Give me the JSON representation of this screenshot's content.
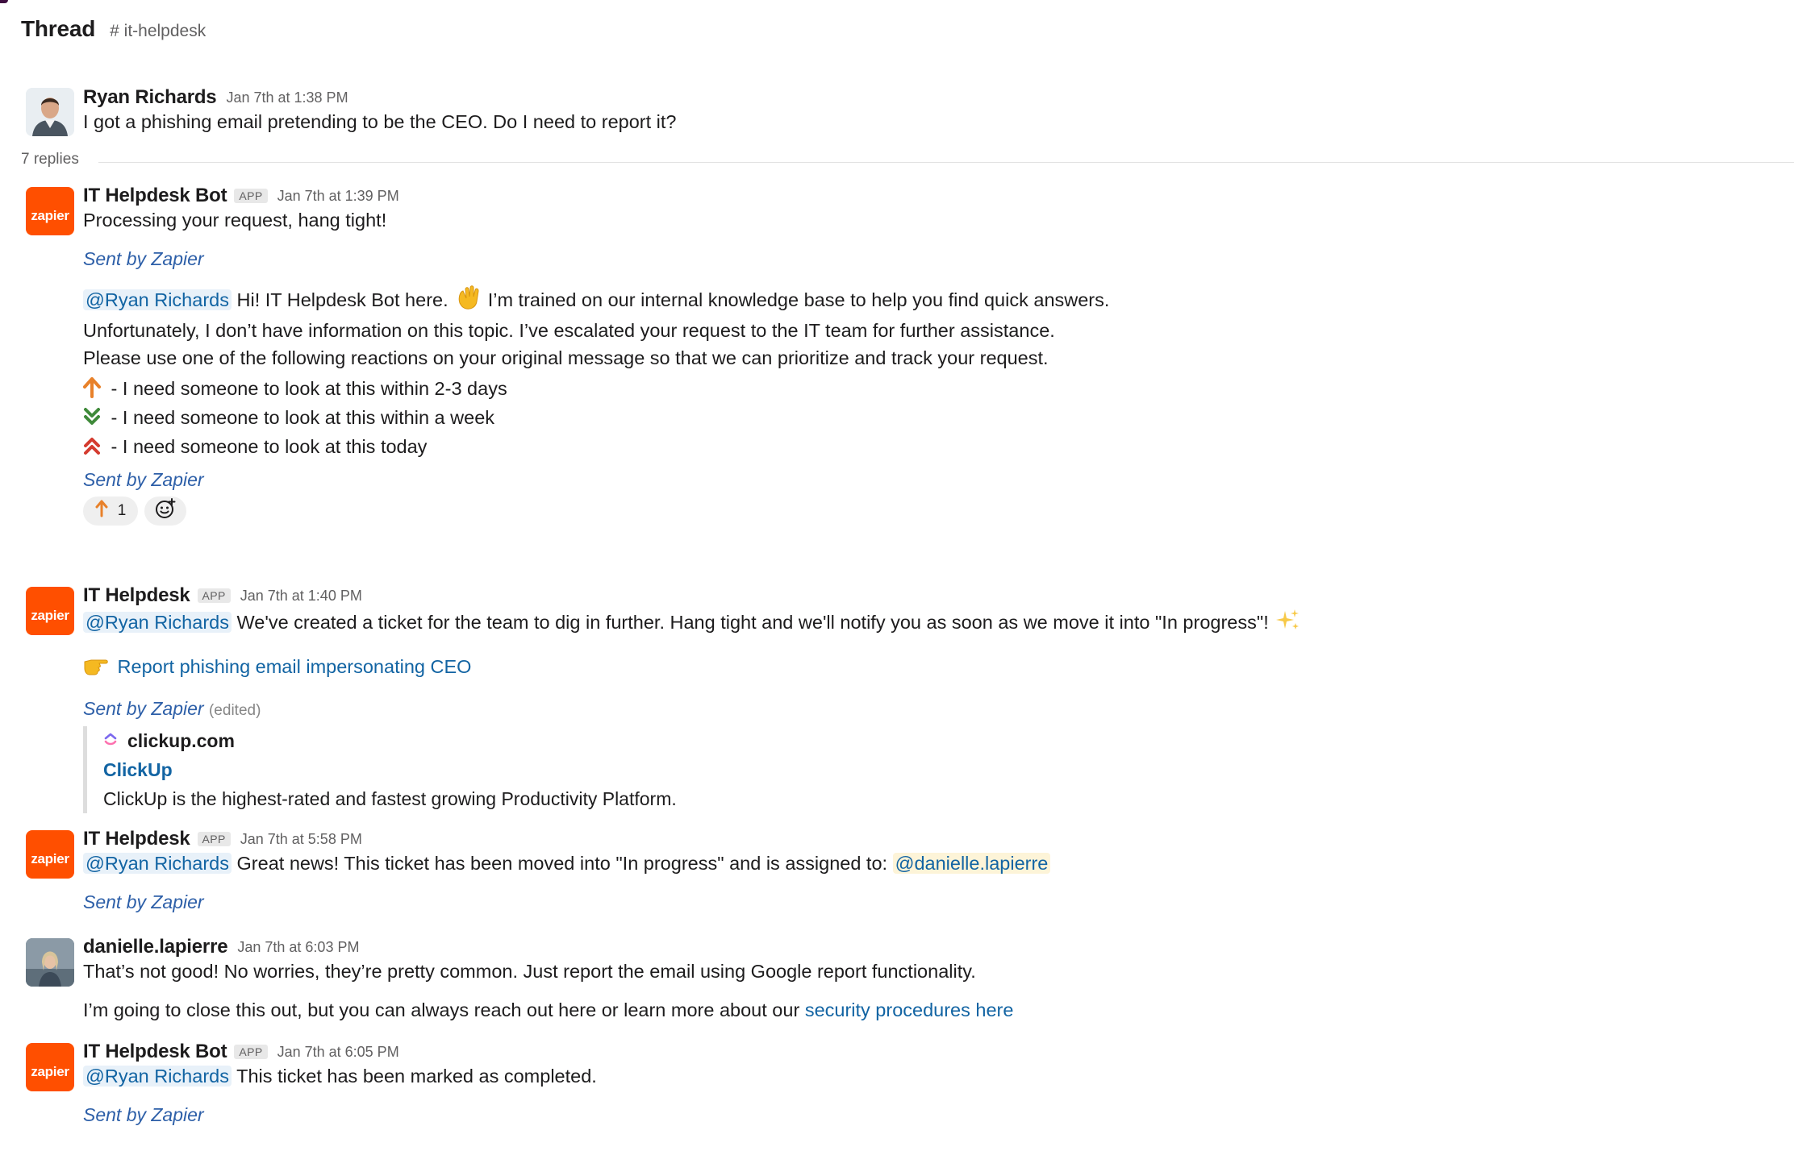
{
  "header": {
    "title": "Thread",
    "channel": "# it-helpdesk"
  },
  "colors": {
    "accent_link": "#1264a3",
    "zapier_orange": "#ff4f00",
    "sent_by": "#2d5fa8"
  },
  "parent": {
    "author": "Ryan Richards",
    "time": "Jan 7th at 1:38 PM",
    "text": "I got a phishing email pretending to be the CEO. Do I need to report it?"
  },
  "replies_label": "7 replies",
  "messages": [
    {
      "author": "IT Helpdesk Bot",
      "badge": "APP",
      "time": "Jan 7th at 1:39 PM",
      "line1": "Processing your request, hang tight!",
      "sent_by_1": "Sent by Zapier",
      "mention": "@Ryan Richards",
      "greeting_a": "Hi! IT Helpdesk Bot here.",
      "greeting_b": "I’m trained on our internal knowledge base to help you find quick answers.",
      "line3": "Unfortunately, I don’t have information on this topic. I’ve escalated your request to the IT team for further assistance.",
      "line4": "Please use one of the following reactions on your original message so that we can prioritize and track your request.",
      "options": [
        {
          "icon": "arrow-up-icon",
          "text": "- I need someone to look at this within 2-3 days"
        },
        {
          "icon": "double-chevron-down-icon",
          "text": "- I need someone to look at this within a week"
        },
        {
          "icon": "double-chevron-up-icon",
          "text": "- I need someone to look at this today"
        }
      ],
      "sent_by_2": "Sent by Zapier",
      "reaction": {
        "icon": "arrow-up-icon",
        "count": "1"
      }
    },
    {
      "author": "IT Helpdesk",
      "badge": "APP",
      "time": "Jan 7th at 1:40 PM",
      "mention": "@Ryan Richards",
      "text": "We've created a ticket for the team to dig in further. Hang tight and we'll notify you as soon as we move it into \"In progress\"!",
      "ticket_link": "Report phishing email impersonating CEO",
      "sent_by": "Sent by Zapier",
      "edited": "(edited)",
      "unfurl": {
        "site": "clickup.com",
        "title": "ClickUp",
        "description": "ClickUp is the highest-rated and fastest growing Productivity Platform."
      }
    },
    {
      "author": "IT Helpdesk",
      "badge": "APP",
      "time": "Jan 7th at 5:58 PM",
      "mention": "@Ryan Richards",
      "text": "Great news! This ticket has been moved into \"In progress\" and is assigned to:",
      "assignee": "@danielle.lapierre",
      "sent_by": "Sent by Zapier"
    },
    {
      "author": "danielle.lapierre",
      "time": "Jan 7th at 6:03 PM",
      "line1": "That’s not good! No worries, they’re pretty common. Just report the email using Google report functionality.",
      "line2": "I’m going to close this out, but you can always reach out here or learn more about our",
      "link": "security procedures here"
    },
    {
      "author": "IT Helpdesk Bot",
      "badge": "APP",
      "time": "Jan 7th at 6:05 PM",
      "mention": "@Ryan Richards",
      "text": "This ticket has been marked as completed.",
      "sent_by": "Sent by Zapier"
    }
  ]
}
